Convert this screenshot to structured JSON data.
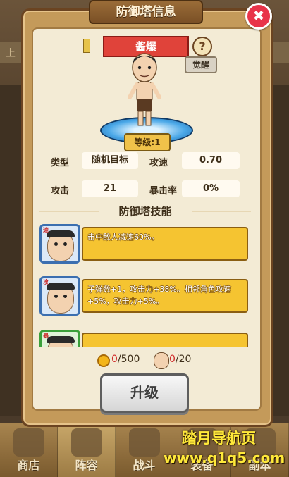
{
  "dialog": {
    "title": "防御塔信息",
    "close_label": "✖"
  },
  "hero": {
    "name": "酱爆",
    "help_label": "?",
    "awaken_label": "觉醒",
    "level_label": "等级:1"
  },
  "stats": {
    "type_label": "类型",
    "type_value": "随机目标",
    "attack_speed_label": "攻速",
    "attack_speed_value": "0.70",
    "attack_label": "攻击",
    "attack_value": "21",
    "crit_label": "暴击率",
    "crit_value": "0%"
  },
  "skills": {
    "header": "防御塔技能",
    "items": [
      {
        "tag": "速",
        "description": "击中敌人减速60%。",
        "frame_color": "#3b6fb0"
      },
      {
        "tag": "攻",
        "description": "子弹数+1，攻击力+38%。相邻角色攻速+5%，攻击力+5%。",
        "frame_color": "#3b6fb0"
      },
      {
        "tag": "暴",
        "description": "",
        "frame_color": "#3aa03a"
      }
    ]
  },
  "cost": {
    "coin_current": "0",
    "coin_required": "/500",
    "shard_current": "0",
    "shard_required": "/20"
  },
  "upgrade_label": "升级",
  "nav": {
    "shop": "商店",
    "lineup": "阵容",
    "battle": "战斗",
    "equipment": "装备",
    "dungeon": "副本"
  },
  "background_strip_label": "上",
  "watermark": {
    "line1": "踏月导航页",
    "line2": "www.q1q5.com"
  }
}
